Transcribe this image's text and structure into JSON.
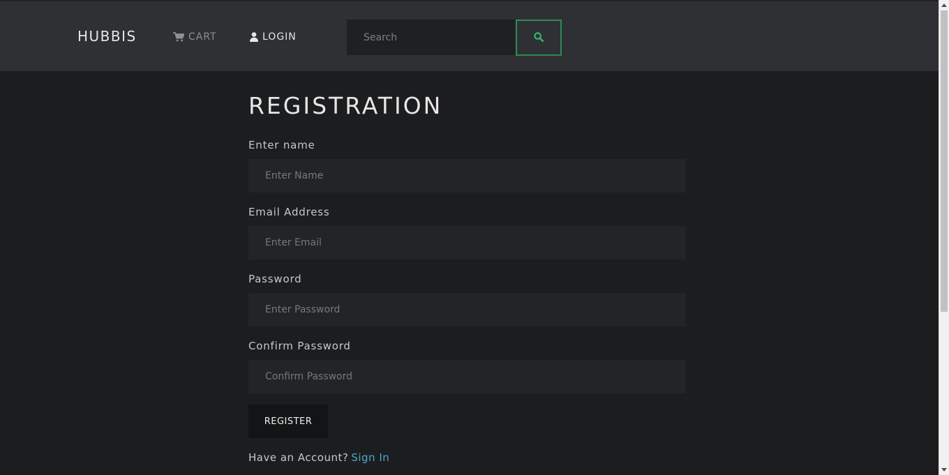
{
  "navbar": {
    "brand": "HUBBIS",
    "cart_label": "CART",
    "login_label": "LOGIN",
    "search": {
      "placeholder": "Search",
      "value": ""
    },
    "accent_color": "#2e8b57"
  },
  "main": {
    "title": "REGISTRATION",
    "fields": [
      {
        "label": "Enter name",
        "placeholder": "Enter Name",
        "value": ""
      },
      {
        "label": "Email Address",
        "placeholder": "Enter Email",
        "value": ""
      },
      {
        "label": "Password",
        "placeholder": "Enter Password",
        "value": ""
      },
      {
        "label": "Confirm Password",
        "placeholder": "Confirm Password",
        "value": ""
      }
    ],
    "register_label": "REGISTER",
    "account_prompt": "Have an Account?",
    "signin_label": "Sign In",
    "link_color": "#4fa7c9"
  },
  "icons": {
    "cart": "cart-icon",
    "login": "user-icon",
    "search": "search-icon"
  }
}
